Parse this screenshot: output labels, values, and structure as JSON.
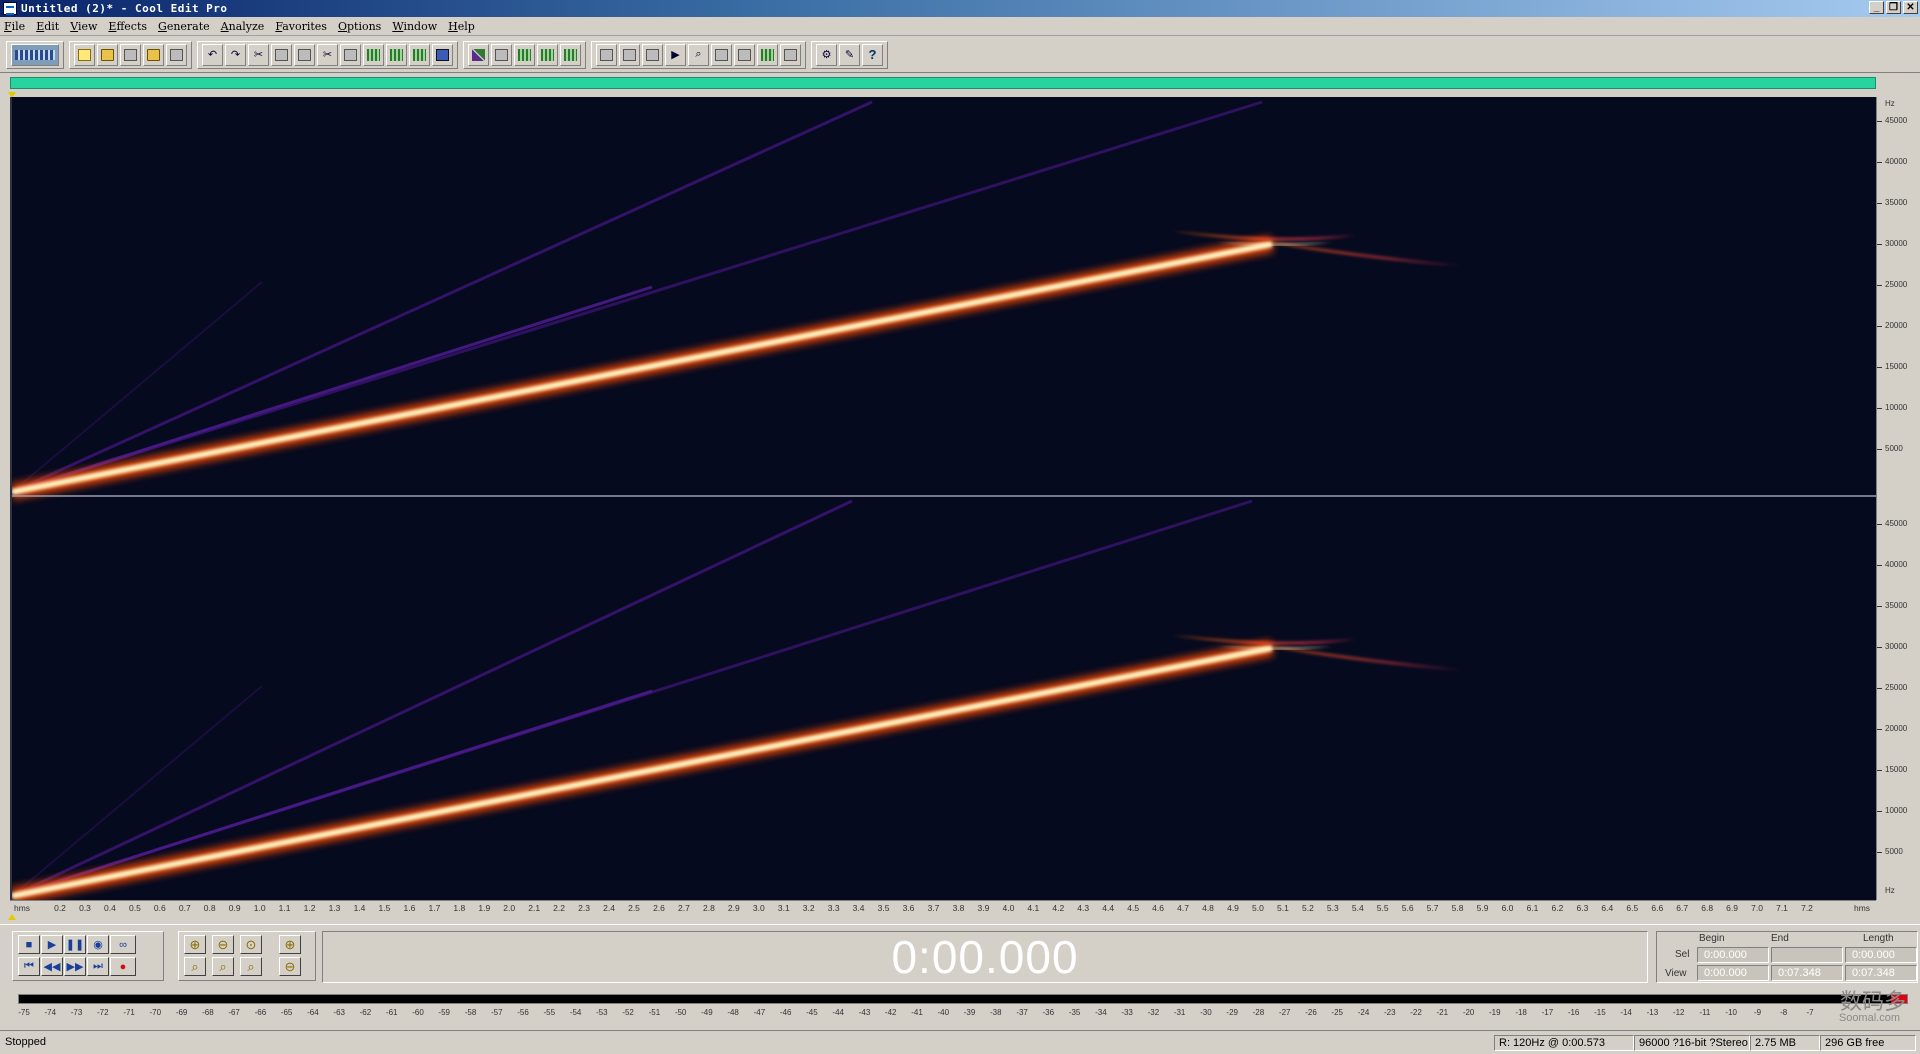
{
  "window": {
    "title": "Untitled (2)* - Cool Edit Pro",
    "min": "_",
    "max": "❐",
    "close": "✕"
  },
  "menu": [
    "File",
    "Edit",
    "View",
    "Effects",
    "Generate",
    "Analyze",
    "Favorites",
    "Options",
    "Window",
    "Help"
  ],
  "hz_ruler": {
    "unit": "Hz",
    "ticks": [
      "45000",
      "40000",
      "35000",
      "30000",
      "25000",
      "20000",
      "15000",
      "10000",
      "5000"
    ]
  },
  "time_ruler": {
    "unit": "hms",
    "ticks": [
      "0.2",
      "0.3",
      "0.4",
      "0.5",
      "0.6",
      "0.7",
      "0.8",
      "0.9",
      "1.0",
      "1.1",
      "1.2",
      "1.3",
      "1.4",
      "1.5",
      "1.6",
      "1.7",
      "1.8",
      "1.9",
      "2.0",
      "2.1",
      "2.2",
      "2.3",
      "2.4",
      "2.5",
      "2.6",
      "2.7",
      "2.8",
      "2.9",
      "3.0",
      "3.1",
      "3.2",
      "3.3",
      "3.4",
      "3.5",
      "3.6",
      "3.7",
      "3.8",
      "3.9",
      "4.0",
      "4.1",
      "4.2",
      "4.3",
      "4.4",
      "4.5",
      "4.6",
      "4.7",
      "4.8",
      "4.9",
      "5.0",
      "5.1",
      "5.2",
      "5.3",
      "5.4",
      "5.5",
      "5.6",
      "5.7",
      "5.8",
      "5.9",
      "6.0",
      "6.1",
      "6.2",
      "6.3",
      "6.4",
      "6.5",
      "6.6",
      "6.7",
      "6.8",
      "6.9",
      "7.0",
      "7.1",
      "7.2"
    ]
  },
  "time_display": "0:00.000",
  "selection": {
    "headers": {
      "begin": "Begin",
      "end": "End",
      "length": "Length"
    },
    "sel": {
      "label": "Sel",
      "begin": "0:00.000",
      "end": "",
      "length": "0:00.000"
    },
    "view": {
      "label": "View",
      "begin": "0:00.000",
      "end": "0:07.348",
      "length": "0:07.348"
    }
  },
  "meter_ticks": [
    "-75",
    "-74",
    "-73",
    "-72",
    "-71",
    "-70",
    "-69",
    "-68",
    "-67",
    "-66",
    "-65",
    "-64",
    "-63",
    "-62",
    "-61",
    "-60",
    "-59",
    "-58",
    "-57",
    "-56",
    "-55",
    "-54",
    "-53",
    "-52",
    "-51",
    "-50",
    "-49",
    "-48",
    "-47",
    "-46",
    "-45",
    "-44",
    "-43",
    "-42",
    "-41",
    "-40",
    "-39",
    "-38",
    "-37",
    "-36",
    "-35",
    "-34",
    "-33",
    "-32",
    "-31",
    "-30",
    "-29",
    "-28",
    "-27",
    "-26",
    "-25",
    "-24",
    "-23",
    "-22",
    "-21",
    "-20",
    "-19",
    "-18",
    "-17",
    "-16",
    "-15",
    "-14",
    "-13",
    "-12",
    "-11",
    "-10",
    "-9",
    "-8",
    "-7"
  ],
  "status": {
    "state": "Stopped",
    "cursor": "R: 120Hz @   0:00.573",
    "format": "96000 ?16-bit ?Stereo",
    "size": "2.75 MB",
    "free": "296 GB free"
  },
  "watermark": {
    "cn": "数码多",
    "en": "Soomal.com"
  },
  "colors": {
    "overview": "#27d4a0",
    "spectral_bg": "#050a1e",
    "sweep_core": "#fffbe0",
    "sweep_glow": "#ff5a00",
    "harmonic": "#4a1a8a",
    "meter_peak": "#e00010"
  }
}
